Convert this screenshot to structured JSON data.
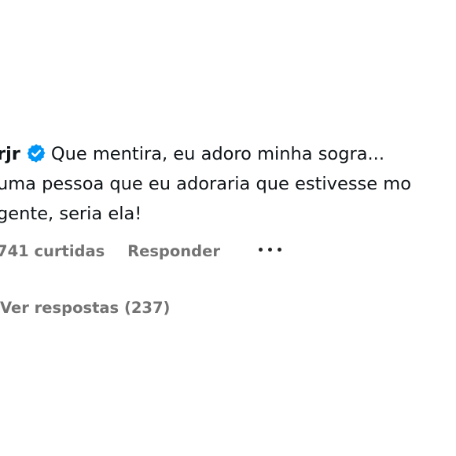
{
  "comment": {
    "username": "rjr",
    "verified_badge_icon": "verified-badge-icon",
    "verified_badge_color": "#0095f6",
    "text_line1": "Que mentira, eu adoro minha sogra...",
    "text_line2": "uma pessoa que eu adoraria que estivesse mo",
    "text_line3": "gente, seria ela!"
  },
  "actions": {
    "likes": "741 curtidas",
    "reply_label": "Responder",
    "more_icon": "more-options-icon"
  },
  "replies": {
    "view_label": "Ver respostas (237)"
  }
}
